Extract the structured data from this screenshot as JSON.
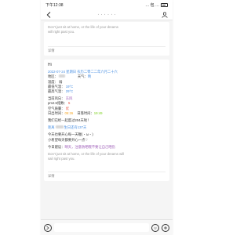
{
  "status_bar": {
    "time": "下午12:38",
    "signal": "… 包 …"
  },
  "nav": {
    "title": "· · · · · ·"
  },
  "card1": {
    "quote_line1": "Don't just sit at home, or the life of your dreams",
    "quote_line2": "will right past you.",
    "detail": "详情"
  },
  "card2": {
    "greeting": "Hi",
    "date_line": "2022-07-24 星期日 农历二零二二年六月二十六",
    "loc_label": "地区：",
    "weather_label": "天气：",
    "weather_value": "晴",
    "temp_label": "温度：",
    "temp_value": "弱",
    "low_label": "最低气温：",
    "low_value": "19°C",
    "high_label": "最高气温：",
    "high_value": "29°C",
    "wind_label": "当前风向：",
    "wind_value": "东风",
    "pm_label": "pm2.5指数：",
    "pm_value": "5",
    "aqi_label": "空气质量：",
    "aqi_value": "优",
    "sunrise_label": "日出时间：",
    "sunrise_value": "05:26",
    "sunset_label": "日落时间：",
    "sunset_value": "19:49",
    "together_line": "我们已经一起度过204天啦！",
    "birthday_prefix": "距离",
    "birthday_suffix": "生日还有137天",
    "hint_line1": "今天也要开心每一天喔(・ω・)",
    "hint_line2": "小希望每天都要开心一点♡",
    "tip_label": "今日建议：",
    "tip_value": "晴天，注意防晒哦不要让自己晒伤",
    "quote_line1": "Don't just sit at home, or the life of your dreams will",
    "quote_line2": "sail right past you.",
    "detail": "详情"
  }
}
